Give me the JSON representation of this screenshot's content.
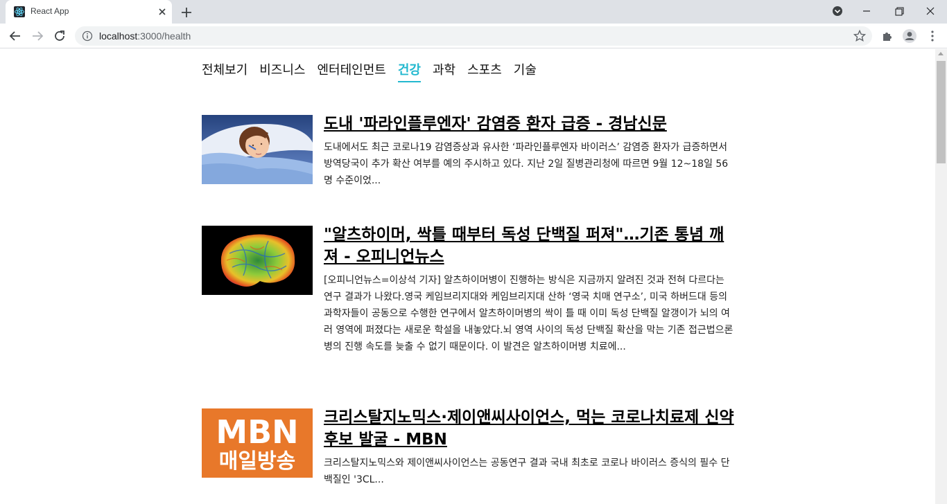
{
  "browser": {
    "tab_title": "React App",
    "url_host": "localhost",
    "url_path": ":3000/health"
  },
  "categories": [
    {
      "label": "전체보기",
      "active": false
    },
    {
      "label": "비즈니스",
      "active": false
    },
    {
      "label": "엔터테인먼트",
      "active": false
    },
    {
      "label": "건강",
      "active": true
    },
    {
      "label": "과학",
      "active": false
    },
    {
      "label": "스포츠",
      "active": false
    },
    {
      "label": "기술",
      "active": false
    }
  ],
  "articles": [
    {
      "title": "도내 '파라인플루엔자' 감염증 환자 급증 - 경남신문",
      "description": "도내에서도 최근 코로나19 감염증상과 유사한 ‘파라인플루엔자 바이러스’ 감염증 환자가 급증하면서 방역당국이 추가 확산 여부를 예의 주시하고 있다. 지난 2일 질병관리청에 따르면 9월 12~18일 56명 수준이었...",
      "image": "sick-person-in-bed"
    },
    {
      "title": "\"알츠하이머, 싹틀 때부터 독성 단백질 퍼져\"…기존 통념 깨져 - 오피니언뉴스",
      "description": "[오피니언뉴스=이상석 기자] 알츠하이머병이 진행하는 방식은 지금까지 알려진 것과 전혀 다르다는 연구 결과가 나왔다.영국 케임브리지대와 케임브리지대 산하 ‘영국 치매 연구소’, 미국 하버드대 등의 과학자들이 공동으로 수행한 연구에서 알츠하이머병의 싹이 틀 때 이미 독성 단백질 알갱이가 뇌의 여러 영역에 퍼졌다는 새로운 학설을 내놓았다.뇌 영역 사이의 독성 단백질 확산을 막는 기존 접근법으론 병의 진행 속도를 늦출 수 없기 때문이다. 이 발견은 알츠하이머병 치료에...",
      "image": "brain-scan"
    },
    {
      "title": "크리스탈지노믹스·제이앤씨사이언스, 먹는 코로나치료제 신약후보 발굴 - MBN",
      "description": "크리스탈지노믹스와 제이앤씨사이언스는 공동연구 결과 국내 최초로 코로나 바이러스 증식의 필수 단백질인 '3CL...",
      "image": "mbn-logo",
      "logo_line1": "MBN",
      "logo_line2": "매일방송"
    }
  ],
  "colors": {
    "accent": "#22b8cf",
    "mbn_orange": "#e8782a"
  }
}
